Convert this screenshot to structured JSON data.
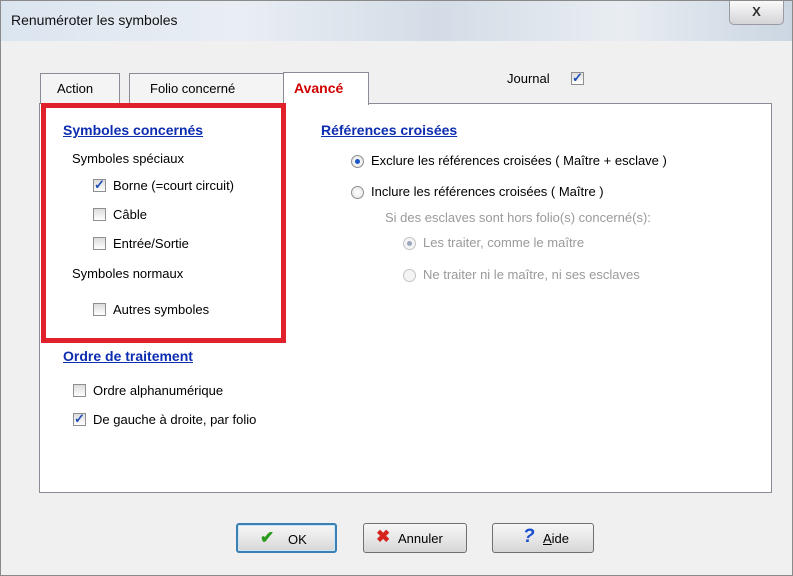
{
  "window": {
    "title": "Renuméroter les symboles",
    "close_glyph": "X"
  },
  "tabs": [
    {
      "label": "Action",
      "active": false
    },
    {
      "label": "Folio concerné",
      "active": false
    },
    {
      "label": "Avancé",
      "active": true
    }
  ],
  "journal": {
    "label": "Journal",
    "checked": true
  },
  "symboles_concernes": {
    "title": "Symboles concernés",
    "special_header": "Symboles spéciaux",
    "special_items": [
      {
        "label": "Borne (=court circuit)",
        "checked": true
      },
      {
        "label": "Câble",
        "checked": false
      },
      {
        "label": "Entrée/Sortie",
        "checked": false
      }
    ],
    "normal_header": "Symboles normaux",
    "normal_items": [
      {
        "label": "Autres symboles",
        "checked": false
      }
    ]
  },
  "ordre_traitement": {
    "title": "Ordre de traitement",
    "items": [
      {
        "label": "Ordre alphanumérique",
        "checked": false
      },
      {
        "label": "De gauche à droite, par folio",
        "checked": true
      }
    ]
  },
  "references_croisees": {
    "title": "Références croisées",
    "options": [
      {
        "label": "Exclure les références croisées ( Maître + esclave )",
        "selected": true
      },
      {
        "label": "Inclure les références croisées ( Maître )",
        "selected": false
      }
    ],
    "sub_prompt": "Si des esclaves sont hors folio(s) concerné(s):",
    "sub_options": [
      {
        "label": "Les traiter, comme le maître",
        "selected": true
      },
      {
        "label": "Ne traiter ni le maître, ni ses esclaves",
        "selected": false
      }
    ]
  },
  "buttons": {
    "ok": {
      "label": "OK",
      "icon": "checkmark-icon",
      "color": "#2a9a1c"
    },
    "cancel": {
      "label": "Annuler",
      "icon": "x-icon",
      "color": "#d4241c"
    },
    "help": {
      "label_rest": "ide",
      "mnemonic": "A",
      "icon": "question-icon",
      "color": "#1c4fcf"
    }
  },
  "colors": {
    "accent_tab": "#d00000",
    "section_title": "#0c2db0",
    "highlight_box": "#e0202a"
  }
}
